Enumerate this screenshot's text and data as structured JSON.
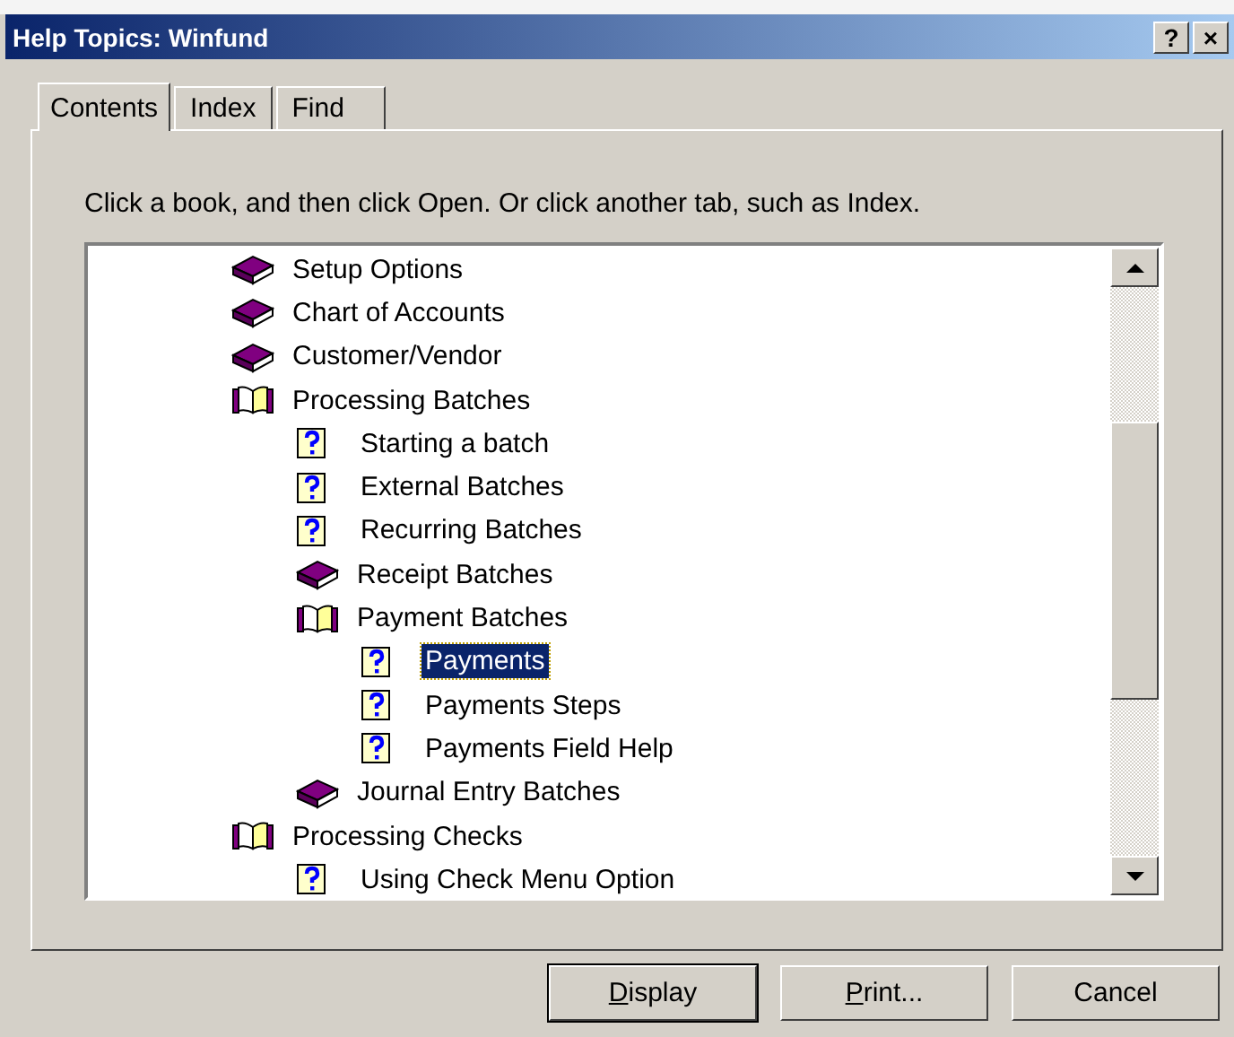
{
  "window": {
    "title": "Help Topics: Winfund",
    "title_buttons": [
      "?",
      "×"
    ]
  },
  "tabs": [
    {
      "label": "Contents",
      "selected": true
    },
    {
      "label": "Index",
      "selected": false
    },
    {
      "label": "Find",
      "selected": false
    }
  ],
  "instruction": "Click a book, and then click Open. Or click another tab, such as Index.",
  "tree": [
    {
      "kind": "book",
      "label": "Setup Options",
      "expanded": false,
      "selected": false
    },
    {
      "kind": "book",
      "label": "Chart of Accounts",
      "expanded": false,
      "selected": false
    },
    {
      "kind": "book",
      "label": "Customer/Vendor",
      "expanded": false,
      "selected": false
    },
    {
      "kind": "book",
      "label": "Processing Batches",
      "expanded": true,
      "selected": false,
      "children": [
        {
          "kind": "page",
          "label": "Starting a batch",
          "selected": false
        },
        {
          "kind": "page",
          "label": "External Batches",
          "selected": false
        },
        {
          "kind": "page",
          "label": "Recurring Batches",
          "selected": false
        },
        {
          "kind": "book",
          "label": "Receipt Batches",
          "expanded": false,
          "selected": false
        },
        {
          "kind": "book",
          "label": "Payment Batches",
          "expanded": true,
          "selected": false,
          "children": [
            {
              "kind": "page",
              "label": "Payments",
              "selected": true
            },
            {
              "kind": "page",
              "label": "Payments Steps",
              "selected": false
            },
            {
              "kind": "page",
              "label": "Payments Field Help",
              "selected": false
            }
          ]
        },
        {
          "kind": "book",
          "label": "Journal Entry Batches",
          "expanded": false,
          "selected": false
        }
      ]
    },
    {
      "kind": "book",
      "label": "Processing Checks",
      "expanded": true,
      "selected": false,
      "children": [
        {
          "kind": "page",
          "label": "Using Check Menu Option",
          "selected": false
        }
      ]
    }
  ],
  "buttons": [
    {
      "label": "Display",
      "underline_first": true,
      "default": true
    },
    {
      "label": "Print...",
      "underline_first": true,
      "default": false
    },
    {
      "label": "Cancel",
      "underline_first": false,
      "default": false
    }
  ]
}
